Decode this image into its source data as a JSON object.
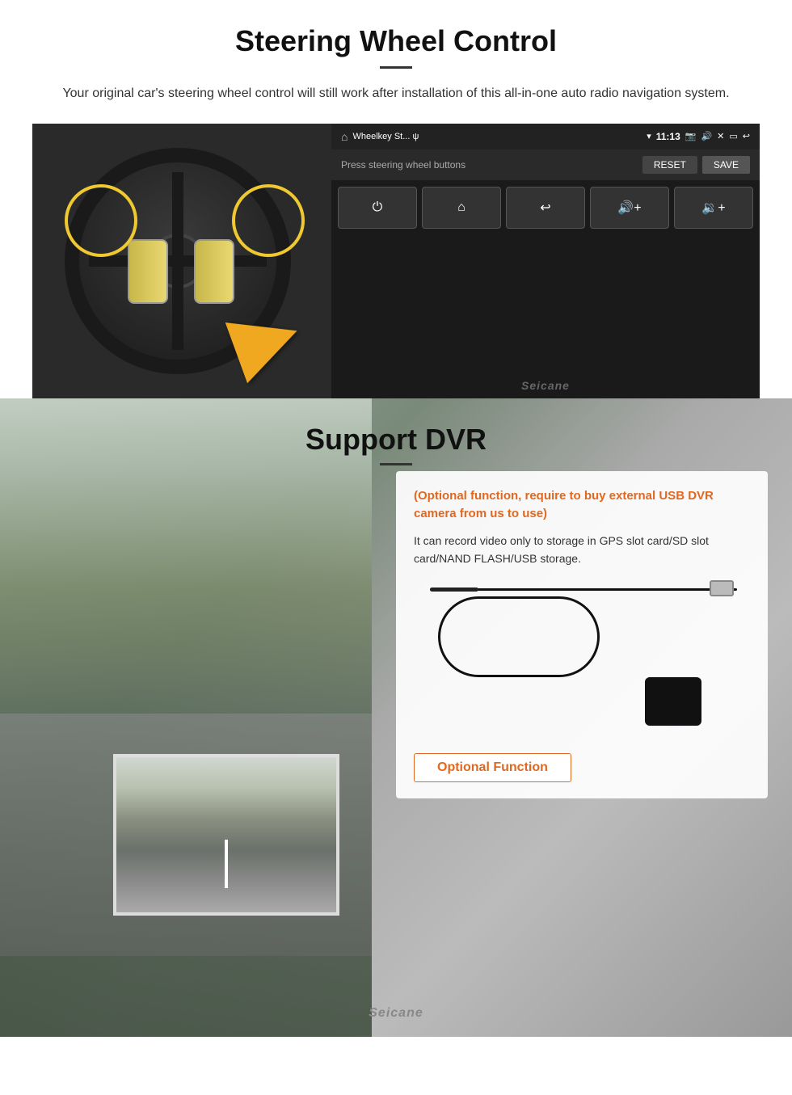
{
  "page": {
    "brand": "Seicane"
  },
  "steering": {
    "title": "Steering Wheel Control",
    "subtitle": "Your original car's steering wheel control will still work after installation of this all-in-one auto radio navigation system.",
    "android": {
      "app_name": "Wheelkey St... ψ",
      "time": "11:13",
      "hint": "Press steering wheel buttons",
      "reset_label": "RESET",
      "save_label": "SAVE",
      "buttons": [
        "⏻",
        "🏠",
        "↩",
        "🔊+",
        "🔉+"
      ]
    }
  },
  "dvr": {
    "title": "Support DVR",
    "card": {
      "optional_text": "(Optional function, require to buy external USB DVR camera from us to use)",
      "description": "It can record video only to storage in GPS slot card/SD slot card/NAND FLASH/USB storage.",
      "optional_btn_label": "Optional Function"
    }
  }
}
